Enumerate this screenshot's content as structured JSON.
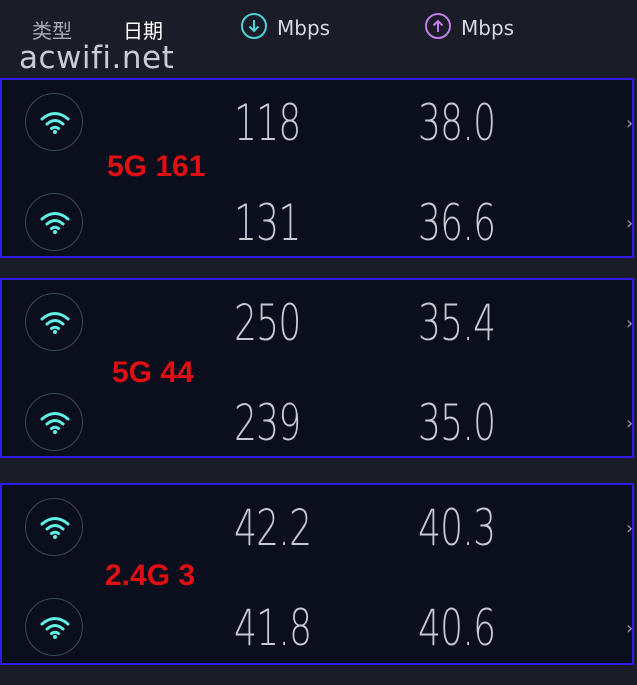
{
  "header": {
    "col_type": "类型",
    "col_date": "日期",
    "download_unit": "Mbps",
    "upload_unit": "Mbps",
    "download_icon": "arrow-down-circle-icon",
    "upload_icon": "arrow-up-circle-icon"
  },
  "watermark": "acwifi.net",
  "colors": {
    "download_accent": "#4ed2d4",
    "upload_accent": "#c27de8",
    "label_red": "#e00f12",
    "group_border": "#2f1be6"
  },
  "groups": [
    {
      "label": "5G 161",
      "rows": [
        {
          "type_icon": "wifi-icon",
          "download": "118",
          "upload": "38.0"
        },
        {
          "type_icon": "wifi-icon",
          "download": "131",
          "upload": "36.6"
        }
      ]
    },
    {
      "label": "5G 44",
      "rows": [
        {
          "type_icon": "wifi-icon",
          "download": "250",
          "upload": "35.4"
        },
        {
          "type_icon": "wifi-icon",
          "download": "239",
          "upload": "35.0"
        }
      ]
    },
    {
      "label": "2.4G 3",
      "rows": [
        {
          "type_icon": "wifi-icon",
          "download": "42.2",
          "upload": "40.3"
        },
        {
          "type_icon": "wifi-icon",
          "download": "41.8",
          "upload": "40.6"
        }
      ]
    }
  ]
}
